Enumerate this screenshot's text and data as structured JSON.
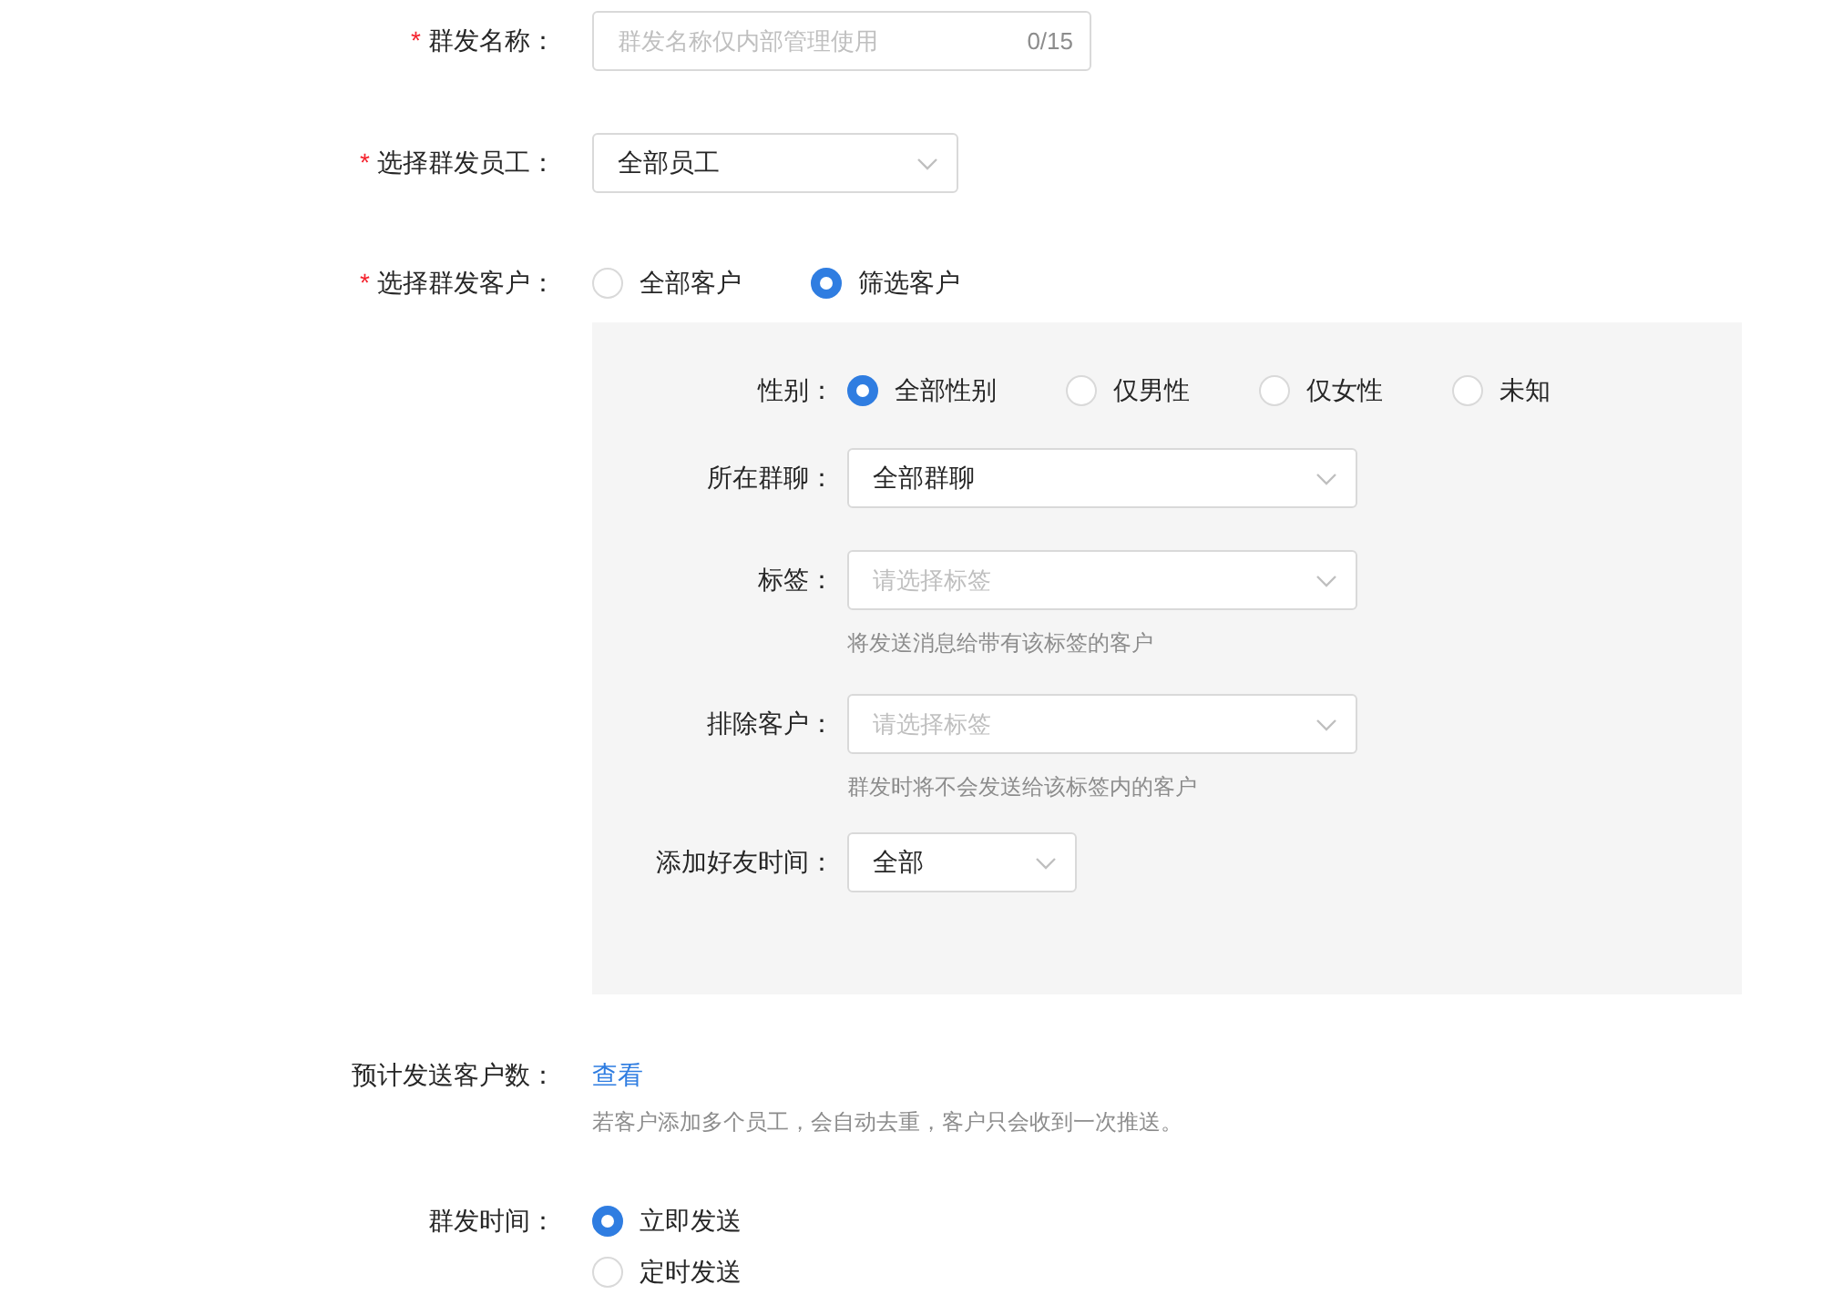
{
  "fields": [
    {
      "kind": "text_input",
      "label": "群发名称：",
      "required_mark": "*",
      "placeholder": "群发名称仅内部管理使用",
      "counter": "0/15"
    },
    {
      "kind": "select",
      "label": "选择群发员工：",
      "required_mark": "*",
      "value": "全部员工"
    },
    {
      "kind": "radio",
      "label": "选择群发客户：",
      "required_mark": "*",
      "options": [
        {
          "label": "全部客户",
          "selected": false
        },
        {
          "label": "筛选客户",
          "selected": true
        }
      ]
    },
    {
      "kind": "filter_panel",
      "fields": [
        {
          "kind": "radio",
          "label": "性别：",
          "options": [
            {
              "label": "全部性别",
              "selected": true
            },
            {
              "label": "仅男性",
              "selected": false
            },
            {
              "label": "仅女性",
              "selected": false
            },
            {
              "label": "未知",
              "selected": false
            }
          ]
        },
        {
          "kind": "select",
          "label": "所在群聊：",
          "value": "全部群聊"
        },
        {
          "kind": "select",
          "label": "标签：",
          "placeholder": "请选择标签",
          "hint": "将发送消息给带有该标签的客户"
        },
        {
          "kind": "select",
          "label": "排除客户：",
          "placeholder": "请选择标签",
          "hint": "群发时将不会发送给该标签内的客户"
        },
        {
          "kind": "select",
          "label": "添加好友时间：",
          "value": "全部"
        }
      ]
    },
    {
      "kind": "link",
      "label": "预计发送客户数：",
      "link": "查看",
      "hint": "若客户添加多个员工，会自动去重，客户只会收到一次推送。"
    },
    {
      "kind": "radio_vertical",
      "label": "群发时间：",
      "options": [
        {
          "label": "立即发送",
          "selected": true
        },
        {
          "label": "定时发送",
          "selected": false
        }
      ]
    }
  ]
}
